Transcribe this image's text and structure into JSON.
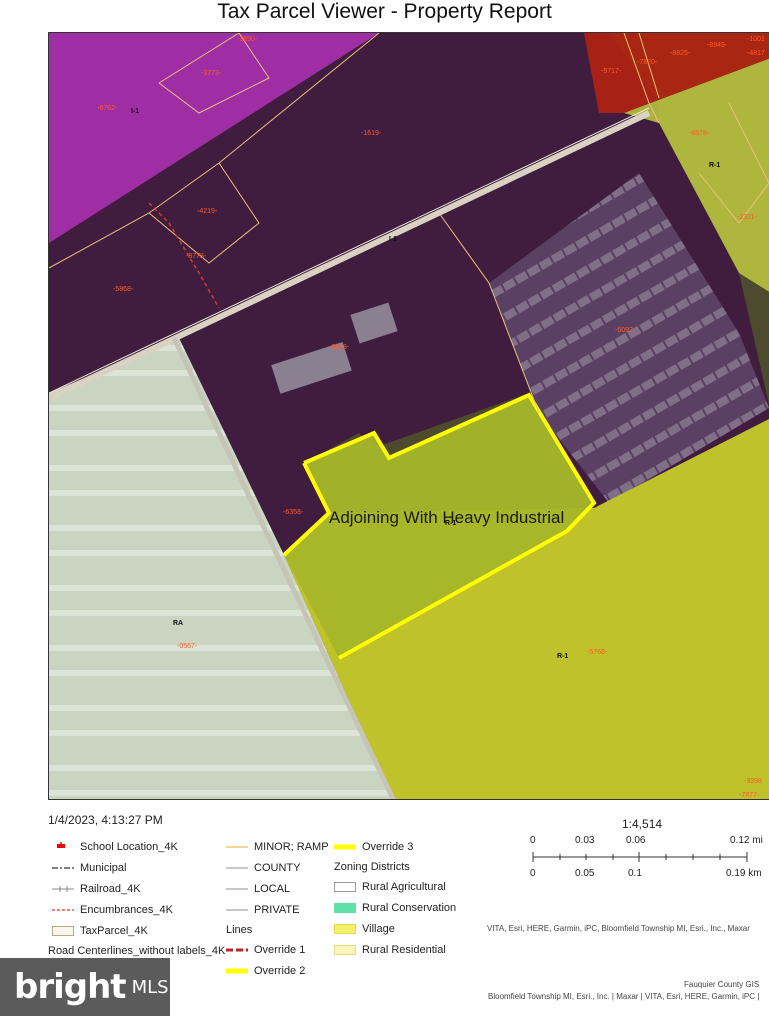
{
  "header": {
    "title": "Tax Parcel Viewer - Property Report"
  },
  "map": {
    "overlay_text": "Adjoining With Heavy Industrial",
    "zone_labels": [
      "I-1",
      "I-2",
      "R-1",
      "RA",
      "R-1",
      "R-1"
    ],
    "parcel_numbers": [
      "-3890-",
      "-3773-",
      "-6762-",
      "-1619-",
      "-4219-",
      "-8778-",
      "-5868-",
      "-8938-",
      "-6358-",
      "-0567-",
      "-5768-",
      "-6092-",
      "-8578-",
      "-2311-",
      "-5717-",
      "-7820-",
      "-8825-",
      "-8949-",
      "-1001",
      "-4817",
      "-3398",
      "-7877-"
    ],
    "colors": {
      "heavy_industrial": "#5a1a5e",
      "light_industrial": "#b01cb8",
      "residential_r1": "#e3e600",
      "agricultural": "#d9e6d9",
      "commercial": "#c8200a",
      "subject_outline": "#ffff00",
      "parcel_lines": "#e8c27a"
    }
  },
  "footer": {
    "timestamp": "1/4/2023, 4:13:27 PM",
    "legend_col1": [
      "School Location_4K",
      "Municipal",
      "Railroad_4K",
      "Encumbrances_4K",
      "TaxParcel_4K",
      "Road Centerlines_without labels_4K"
    ],
    "legend_col2": [
      "MINOR; RAMP",
      "COUNTY",
      "LOCAL",
      "PRIVATE"
    ],
    "lines_heading": "Lines",
    "lines_items": [
      "Override 1",
      "Override 2"
    ],
    "legend_col3_override": "Override 3",
    "zoning_heading": "Zoning Districts",
    "zoning_items": [
      "Rural Agricultural",
      "Rural Conservation",
      "Village",
      "Rural Residential"
    ],
    "scale_ratio": "1:4,514",
    "scale_mi": [
      "0",
      "0.03",
      "0.06",
      "0.12 mi"
    ],
    "scale_km": [
      "0",
      "0.05",
      "0.1",
      "0.19 km"
    ],
    "attribution_1": "VITA, Esri, HERE, Garmin, iPC, Bloomfield Township MI, Esri., Inc., Maxar",
    "attribution_2": "Fauquier County GIS",
    "attribution_3": "Bloomfield Township MI, Esri., Inc. | Maxar | VITA, Esri, HERE, Garmin, iPC |",
    "watermark_brand": "bright",
    "watermark_mls": "MLS"
  }
}
